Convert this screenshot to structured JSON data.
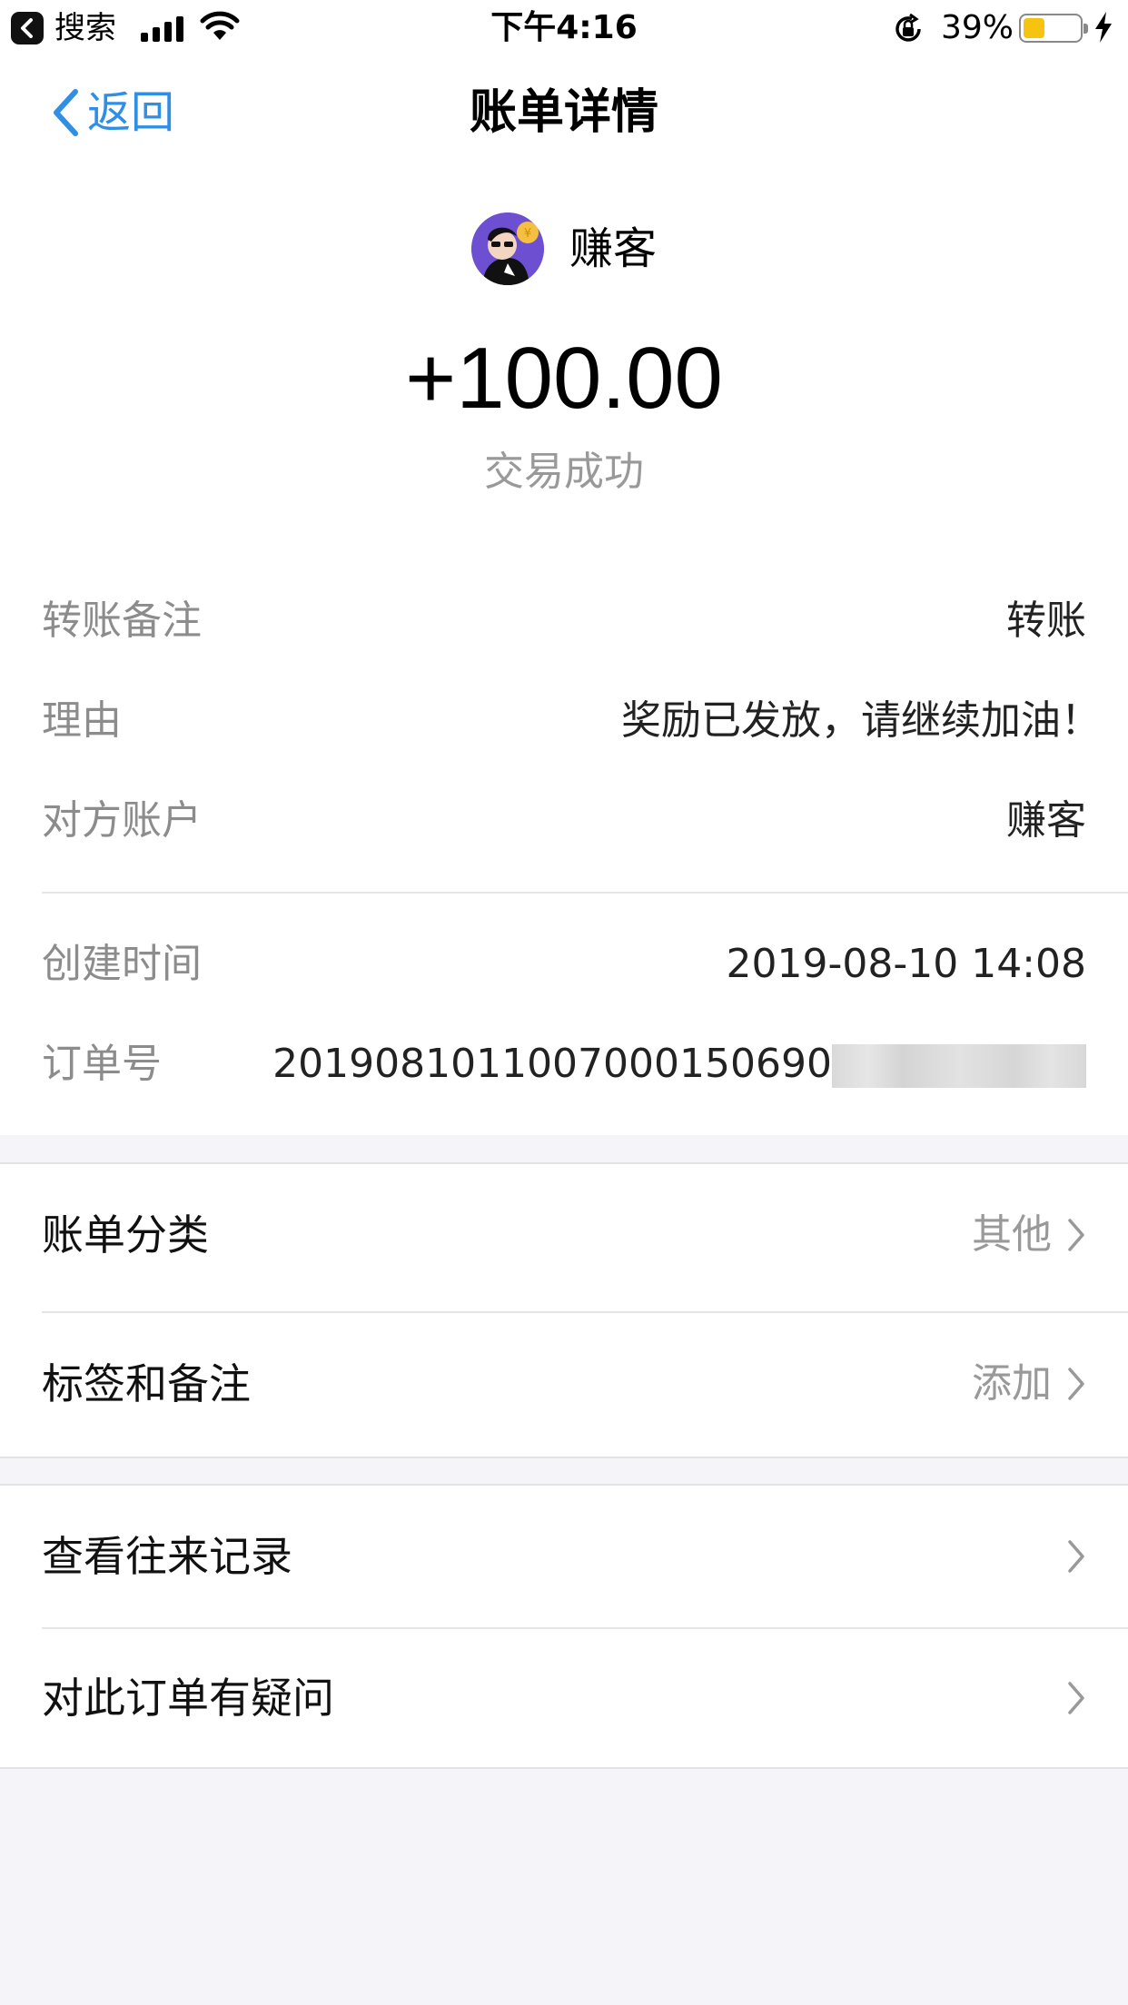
{
  "status_bar": {
    "back_app": "搜索",
    "time": "下午4:16",
    "battery": "39%",
    "battery_level": 0.39,
    "icons": [
      "back-arrow-icon",
      "cellular-signal-icon",
      "wifi-icon",
      "rotation-lock-icon",
      "battery-icon",
      "charging-bolt-icon"
    ]
  },
  "nav": {
    "back_label": "返回",
    "title": "账单详情"
  },
  "header": {
    "merchant_name": "赚客",
    "amount": "+100.00",
    "status": "交易成功"
  },
  "details": [
    {
      "label": "转账备注",
      "value": "转账"
    },
    {
      "label": "理由",
      "value": "奖励已发放，请继续加油！"
    },
    {
      "label": "对方账户",
      "value": "赚客"
    },
    {
      "label": "创建时间",
      "value": "2019-08-10 14:08"
    },
    {
      "label": "订单号",
      "value": "2019081011007000150690"
    }
  ],
  "section1": [
    {
      "label": "账单分类",
      "hint": "其他"
    },
    {
      "label": "标签和备注",
      "hint": "添加"
    }
  ],
  "section2": [
    {
      "label": "查看往来记录"
    },
    {
      "label": "对此订单有疑问"
    }
  ],
  "colors": {
    "accent": "#2f8ee5",
    "battery": "#f6c311",
    "label_gray": "#8c8c8c",
    "background": "#f5f5f9"
  }
}
